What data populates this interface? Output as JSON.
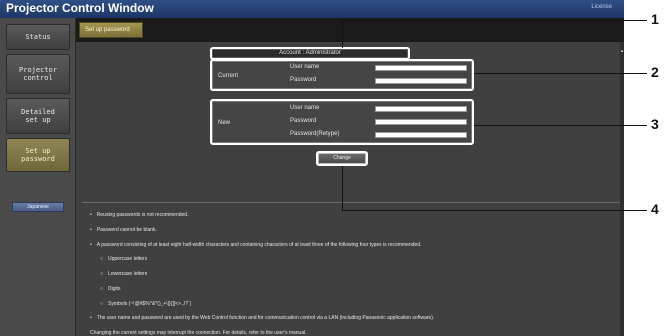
{
  "app": {
    "title": "Projector Control Window",
    "license_link": "License"
  },
  "sidebar": {
    "items": [
      {
        "label": "Status"
      },
      {
        "label": "Projector\ncontrol"
      },
      {
        "label": "Detailed\nset up"
      },
      {
        "label": "Set up\npassword"
      }
    ],
    "language_button": "Japanese"
  },
  "tabs": {
    "active_label": "Set up password"
  },
  "account": {
    "header": "Account  :  Administrator"
  },
  "current_section": {
    "title": "Current",
    "username_label": "User name",
    "password_label": "Password",
    "username_value": "",
    "password_value": ""
  },
  "new_section": {
    "title": "New",
    "username_label": "User name",
    "password_label": "Password",
    "retype_label": "Password(Retype)",
    "username_value": "",
    "password_value": "",
    "retype_value": ""
  },
  "change_button": "Change",
  "notes": [
    "Reusing passwords is not recommended.",
    "Password cannot be blank.",
    "A password consisting of at least eight half-width characters and containing characters of at least three of the following four types is recommended.",
    "Uppercase letters",
    "Lowercase letters",
    "Digits",
    "Symbols (~!@#$%^&*()_+\\|}{][<>.,/?`)",
    "The user name and password are used by the Web Control function and for communication control via a LAN (including Panasonic application software).",
    "Changing the current settings may interrupt the connection. For details, refer to the user's manual."
  ],
  "bullets": {
    "main": "•",
    "sub": "○"
  },
  "callouts": [
    "1",
    "2",
    "3",
    "4"
  ]
}
